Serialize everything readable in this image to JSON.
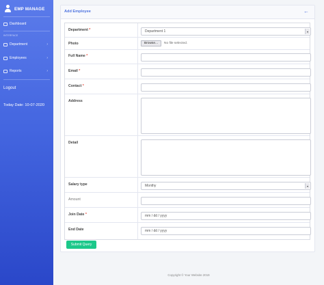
{
  "sidebar": {
    "brand": "EMP MANAGE",
    "dashboard": "Dashboard",
    "section": "INTERFACE",
    "items": [
      {
        "label": "Department"
      },
      {
        "label": "Employees"
      },
      {
        "label": "Reports"
      }
    ],
    "logout": "Logout",
    "today": "Today Date: 10-07-2020"
  },
  "card": {
    "title": "Add Employee",
    "back_icon": "←"
  },
  "form": {
    "department": {
      "label": "Department",
      "value": "Department 1"
    },
    "photo": {
      "label": "Photo",
      "button": "Browse...",
      "status": "No file selected."
    },
    "full_name": {
      "label": "Full Name"
    },
    "email": {
      "label": "Email"
    },
    "contact": {
      "label": "Contact"
    },
    "address": {
      "label": "Address"
    },
    "detail": {
      "label": "Detail"
    },
    "salary_type": {
      "label": "Salary type",
      "value": "Monthy"
    },
    "amount": {
      "label": "Amount"
    },
    "join_date": {
      "label": "Join Date",
      "placeholder": "mm / dd / yyyy"
    },
    "end_date": {
      "label": "End Date",
      "placeholder": "mm / dd / yyyy"
    },
    "required_mark": "*",
    "submit": "Submit Query"
  },
  "footer": "Copyright © Your Website 2019",
  "colors": {
    "accent": "#4e73df",
    "success": "#1cc88a",
    "danger": "#e74a3b"
  }
}
